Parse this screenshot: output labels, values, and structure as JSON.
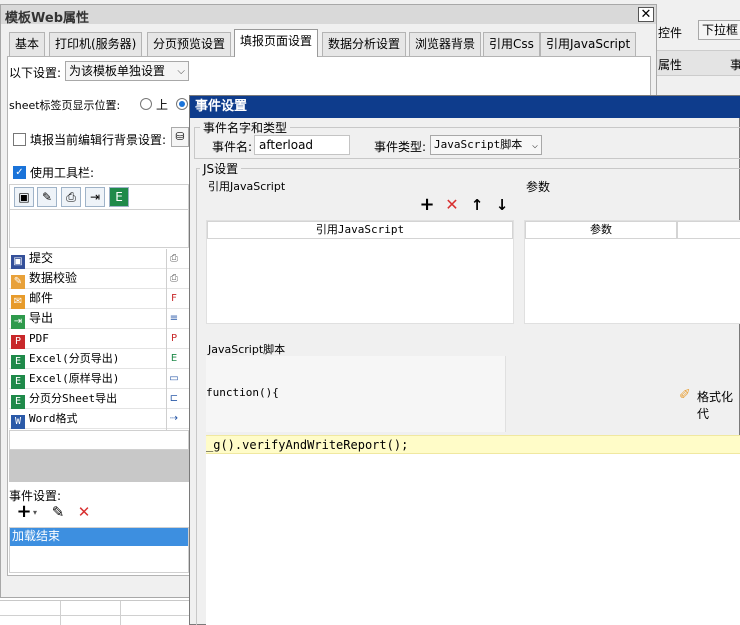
{
  "background": {
    "right_label_1": "控件",
    "right_combo": "下拉框",
    "right_label_2": "属性",
    "right_label_3": "事"
  },
  "main_dialog": {
    "title": "模板Web属性",
    "close_glyph": "✕",
    "tabs": [
      "基本",
      "打印机(服务器)",
      "分页预览设置",
      "填报页面设置",
      "数据分析设置",
      "浏览器背景",
      "引用Css",
      "引用JavaScript"
    ],
    "active_tab": "填报页面设置",
    "settings_label": "以下设置:",
    "settings_value": "为该模板单独设置",
    "sheet_pos_label": "sheet标签页显示位置:",
    "sheet_pos_opt1": "上",
    "bg_fill_label": "填报当前编辑行背景设置:",
    "use_toolbar_label": "使用工具栏:",
    "check_glyph": "✓",
    "toolbar_items": [
      {
        "name": "提交",
        "icon": "save-icon"
      },
      {
        "name": "数据校验",
        "icon": "pencil-icon"
      },
      {
        "name": "邮件",
        "icon": "mail-icon"
      },
      {
        "name": "导出",
        "icon": "export-icon"
      },
      {
        "name": "PDF",
        "icon": "pdf-icon"
      },
      {
        "name": "Excel(分页导出)",
        "icon": "excel-icon"
      },
      {
        "name": "Excel(原样导出)",
        "icon": "excel-icon"
      },
      {
        "name": "分页分Sheet导出",
        "icon": "excel-icon"
      },
      {
        "name": "Word格式",
        "icon": "word-icon"
      }
    ],
    "event_settings_label": "事件设置:",
    "add_glyph": "+",
    "events": [
      "加载结束"
    ]
  },
  "event_dialog": {
    "title": "事件设置",
    "group_name_type": "事件名字和类型",
    "event_name_label": "事件名:",
    "event_name_value": "afterload",
    "event_type_label": "事件类型:",
    "event_type_value": "JavaScript脚本",
    "js_settings_label": "JS设置",
    "ref_js_label": "引用JavaScript",
    "params_label": "参数",
    "col_ref_js": "引用JavaScript",
    "col_params": "参数",
    "script_label": "JavaScript脚本",
    "function_text": "function(){",
    "format_label": "格式化代",
    "code_line": "_g().verifyAndWriteReport();",
    "colors": {
      "title_bar": "#0e3c8c",
      "code_highlight": "#fffcc8",
      "selection": "#3d8fe0"
    }
  }
}
